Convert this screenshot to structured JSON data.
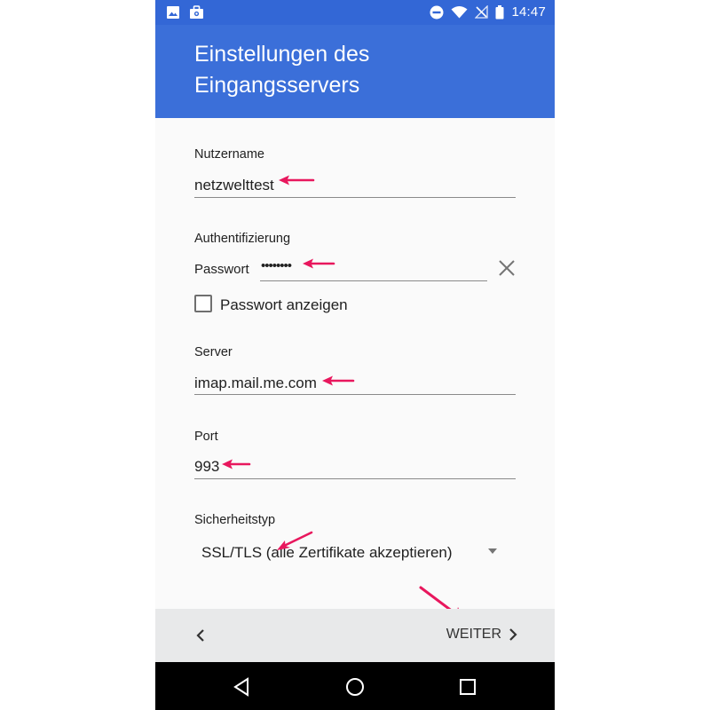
{
  "status_bar": {
    "time": "14:47",
    "icons": [
      "image-icon",
      "bag-icon",
      "do-not-disturb-icon",
      "wifi-icon",
      "no-signal-icon",
      "battery-icon"
    ]
  },
  "header": {
    "title": "Einstellungen des Eingangsservers"
  },
  "form": {
    "username": {
      "label": "Nutzername",
      "value": "netzwelttest"
    },
    "auth": {
      "label": "Authentifizierung",
      "password_label": "Passwort",
      "password_value": "••••••••",
      "show_password_label": "Passwort anzeigen"
    },
    "server": {
      "label": "Server",
      "value": "imap.mail.me.com"
    },
    "port": {
      "label": "Port",
      "value": "993"
    },
    "security": {
      "label": "Sicherheitstyp",
      "value": "SSL/TLS (alle Zertifikate akzeptieren)"
    }
  },
  "footer": {
    "next_label": "WEITER"
  },
  "colors": {
    "appbar": "#3b6fd9",
    "statusbar": "#3367d6",
    "annotation_arrow": "#e8175d",
    "bottombar": "#e8e9ea"
  }
}
